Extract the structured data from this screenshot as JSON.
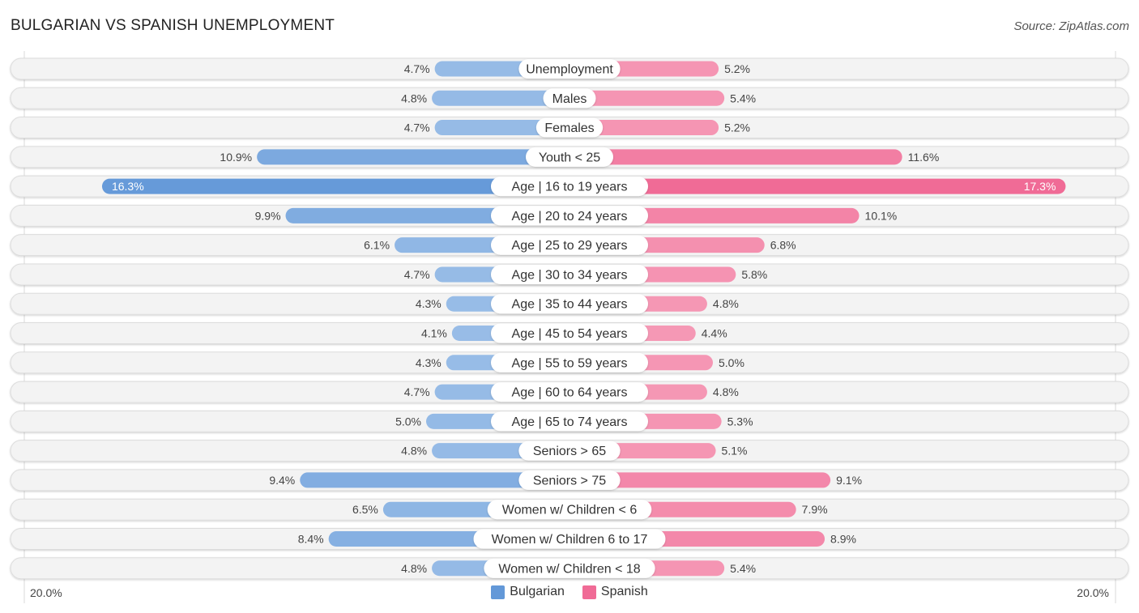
{
  "header": {
    "title": "BULGARIAN VS SPANISH UNEMPLOYMENT",
    "source": "Source: ZipAtlas.com"
  },
  "legend": {
    "items": [
      {
        "label": "Bulgarian",
        "color": "#6398d8"
      },
      {
        "label": "Spanish",
        "color": "#f06b96"
      }
    ]
  },
  "axis": {
    "left_label": "20.0%",
    "right_label": "20.0%"
  },
  "chart_data": {
    "type": "bar",
    "orientation": "horizontal-diverging",
    "title": "BULGARIAN VS SPANISH UNEMPLOYMENT",
    "xlabel": "",
    "ylabel": "",
    "xlim": [
      -20,
      20
    ],
    "unit": "%",
    "legend_position": "bottom-center",
    "categories": [
      "Unemployment",
      "Males",
      "Females",
      "Youth < 25",
      "Age | 16 to 19 years",
      "Age | 20 to 24 years",
      "Age | 25 to 29 years",
      "Age | 30 to 34 years",
      "Age | 35 to 44 years",
      "Age | 45 to 54 years",
      "Age | 55 to 59 years",
      "Age | 60 to 64 years",
      "Age | 65 to 74 years",
      "Seniors > 65",
      "Seniors > 75",
      "Women w/ Children < 6",
      "Women w/ Children 6 to 17",
      "Women w/ Children < 18"
    ],
    "series": [
      {
        "name": "Bulgarian",
        "color": "#6398d8",
        "values": [
          4.7,
          4.8,
          4.7,
          10.9,
          16.3,
          9.9,
          6.1,
          4.7,
          4.3,
          4.1,
          4.3,
          4.7,
          5.0,
          4.8,
          9.4,
          6.5,
          8.4,
          4.8
        ],
        "labels": [
          "4.7%",
          "4.8%",
          "4.7%",
          "10.9%",
          "16.3%",
          "9.9%",
          "6.1%",
          "4.7%",
          "4.3%",
          "4.1%",
          "4.3%",
          "4.7%",
          "5.0%",
          "4.8%",
          "9.4%",
          "6.5%",
          "8.4%",
          "4.8%"
        ]
      },
      {
        "name": "Spanish",
        "color": "#f06b96",
        "values": [
          5.2,
          5.4,
          5.2,
          11.6,
          17.3,
          10.1,
          6.8,
          5.8,
          4.8,
          4.4,
          5.0,
          4.8,
          5.3,
          5.1,
          9.1,
          7.9,
          8.9,
          5.4
        ],
        "labels": [
          "5.2%",
          "5.4%",
          "5.2%",
          "11.6%",
          "17.3%",
          "10.1%",
          "6.8%",
          "5.8%",
          "4.8%",
          "4.4%",
          "5.0%",
          "4.8%",
          "5.3%",
          "5.1%",
          "9.1%",
          "7.9%",
          "8.9%",
          "5.4%"
        ]
      }
    ]
  }
}
